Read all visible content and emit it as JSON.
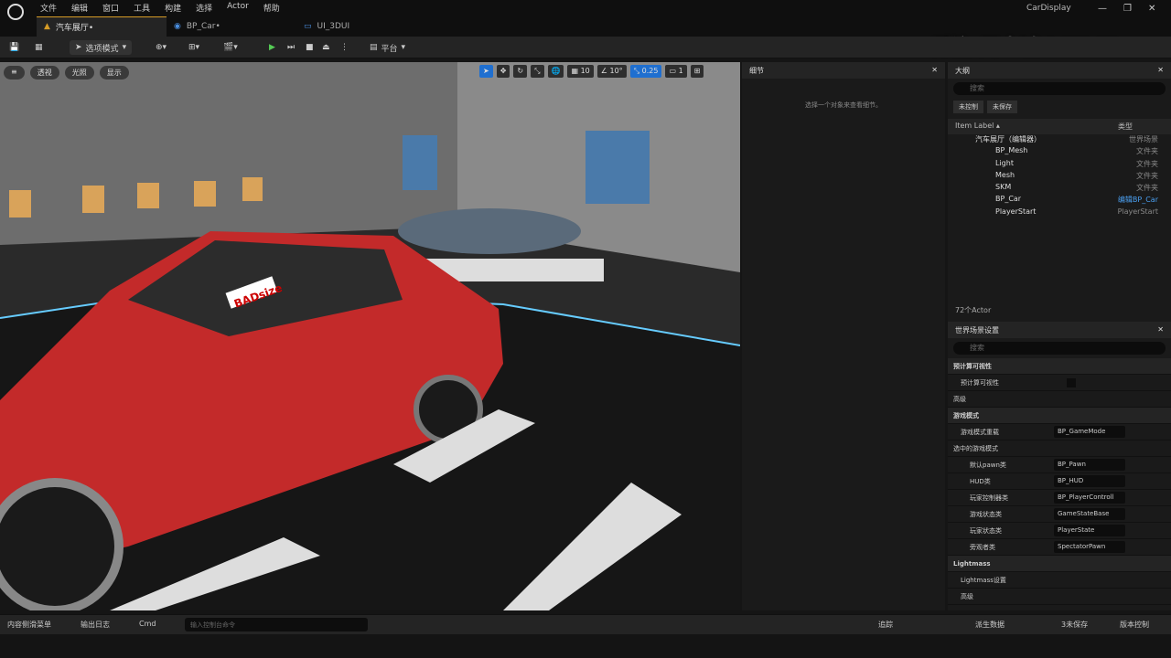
{
  "menu": [
    "文件",
    "编辑",
    "窗口",
    "工具",
    "构建",
    "选择",
    "Actor",
    "帮助"
  ],
  "tabs": [
    {
      "label": "汽车展厅•"
    },
    {
      "label": "BP_Car•"
    },
    {
      "label": "UI_3DUI"
    }
  ],
  "app_name": "CarDisplay",
  "watermark": "乔治-周士诚 bilibili",
  "toolbar": {
    "mode": "选项模式",
    "platform": "平台"
  },
  "viewport": {
    "perspective": "透视",
    "lit": "光照",
    "show": "显示",
    "grid": "10",
    "angle": "10°",
    "scale": "0.25",
    "cam": "1",
    "sticker": "BADsize"
  },
  "details": {
    "title": "细节",
    "empty": "选择一个对象来查看细节。"
  },
  "outliner": {
    "title": "大纲",
    "search": "搜索",
    "chips": [
      "未控制",
      "未保存"
    ],
    "col_label": "Item Label ▴",
    "col_type": "类型",
    "items": [
      {
        "label": "汽车展厅（编辑器）",
        "type": "世界场景",
        "depth": 0
      },
      {
        "label": "BP_Mesh",
        "type": "文件夹",
        "depth": 1
      },
      {
        "label": "Light",
        "type": "文件夹",
        "depth": 1
      },
      {
        "label": "Mesh",
        "type": "文件夹",
        "depth": 1
      },
      {
        "label": "SKM",
        "type": "文件夹",
        "depth": 1
      },
      {
        "label": "BP_Car",
        "type": "编辑BP_Car",
        "depth": 1
      },
      {
        "label": "PlayerStart",
        "type": "PlayerStart",
        "depth": 1
      }
    ],
    "count": "72个Actor"
  },
  "world": {
    "title": "世界场景设置",
    "search": "搜索",
    "rows": [
      {
        "label": "预计算可视性",
        "value": "",
        "sec": true
      },
      {
        "label": "预计算可视性",
        "value": ""
      },
      {
        "label": "高级",
        "value": "",
        "sec": false
      },
      {
        "label": "游戏模式",
        "value": "",
        "sec": true
      },
      {
        "label": "游戏模式重载",
        "value": "BP_GameMode"
      },
      {
        "label": "选中的游戏模式",
        "value": ""
      },
      {
        "label": "默认pawn类",
        "value": "BP_Pawn"
      },
      {
        "label": "HUD类",
        "value": "BP_HUD"
      },
      {
        "label": "玩家控制器类",
        "value": "BP_PlayerControll"
      },
      {
        "label": "游戏状态类",
        "value": "GameStateBase"
      },
      {
        "label": "玩家状态类",
        "value": "PlayerState"
      },
      {
        "label": "旁观者类",
        "value": "SpectatorPawn"
      },
      {
        "label": "Lightmass",
        "value": "",
        "sec": true
      },
      {
        "label": "Lightmass设置",
        "value": ""
      },
      {
        "label": "高级",
        "value": ""
      }
    ]
  },
  "status": {
    "drawer": "内容侧滑菜单",
    "log": "输出日志",
    "cmd": "Cmd",
    "cmd_ph": "输入控制台命令",
    "track": "追踪",
    "derived": "派生数据",
    "unsaved": "3未保存",
    "source": "版本控制"
  }
}
